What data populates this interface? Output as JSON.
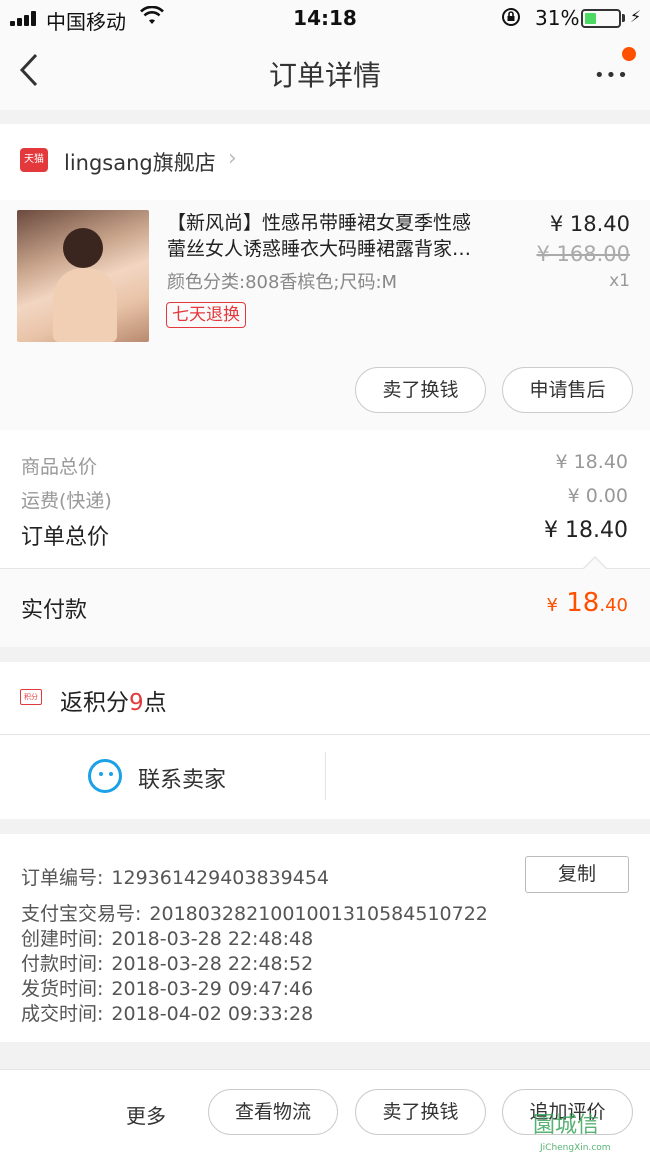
{
  "status_bar": {
    "carrier": "中国移动",
    "time": "14:18",
    "battery_percent": "31%",
    "battery_level": 0.31,
    "wifi_icon": "wifi-icon",
    "lock_icon": "rotation-lock-icon",
    "charging_icon": "bolt-icon"
  },
  "nav": {
    "title": "订单详情",
    "back_icon": "chevron-left-icon",
    "more_icon": "more-dots-icon",
    "more_glyph": "•••"
  },
  "store": {
    "logo_text": "天猫",
    "name": "lingsang旗舰店",
    "chevron": "›"
  },
  "product": {
    "title_line1": "【新风尚】性感吊带睡裙女夏季性感",
    "title_line2": "蕾丝女人诱惑睡衣大码睡裙露背家…",
    "sku": "颜色分类:808香槟色;尺码:M",
    "tag": "七天退换",
    "price": "¥ 18.40",
    "original_price": "¥ 168.00",
    "quantity": "x1"
  },
  "item_actions": {
    "sell_label": "卖了换钱",
    "after_sale_label": "申请售后"
  },
  "summary": {
    "goods_total_label": "商品总价",
    "goods_total_value": "¥ 18.40",
    "shipping_label": "运费(快递)",
    "shipping_value": "¥ 0.00",
    "order_total_label": "订单总价",
    "order_total_value": "¥ 18.40",
    "paid_label": "实付款",
    "paid_currency": "¥",
    "paid_int": "18",
    "paid_dec": ".40"
  },
  "points": {
    "icon_text": "积分",
    "prefix": "返积分",
    "number": "9",
    "suffix": "点"
  },
  "contact": {
    "label": "联系卖家",
    "icon": "chat-bubble-icon"
  },
  "order_info": {
    "order_no_label": "订单编号:",
    "order_no": "129361429403839454",
    "copy_label": "复制",
    "alipay_label": "支付宝交易号:",
    "alipay_no": "2018032821001001310584510722",
    "created_label": "创建时间:",
    "created": "2018-03-28 22:48:48",
    "paid_label": "付款时间:",
    "paid": "2018-03-28 22:48:52",
    "shipped_label": "发货时间:",
    "shipped": "2018-03-29 09:47:46",
    "done_label": "成交时间:",
    "done": "2018-04-02 09:33:28"
  },
  "bottom_bar": {
    "more_label": "更多",
    "logistics_label": "查看物流",
    "sell_label": "卖了换钱",
    "review_label": "追加评价"
  },
  "watermark": {
    "text": "園城信",
    "sub": "JiChengXin.com"
  },
  "colors": {
    "accent": "#ff5000",
    "tmall_red": "#e4393c",
    "contact_blue": "#1aa1e6"
  }
}
